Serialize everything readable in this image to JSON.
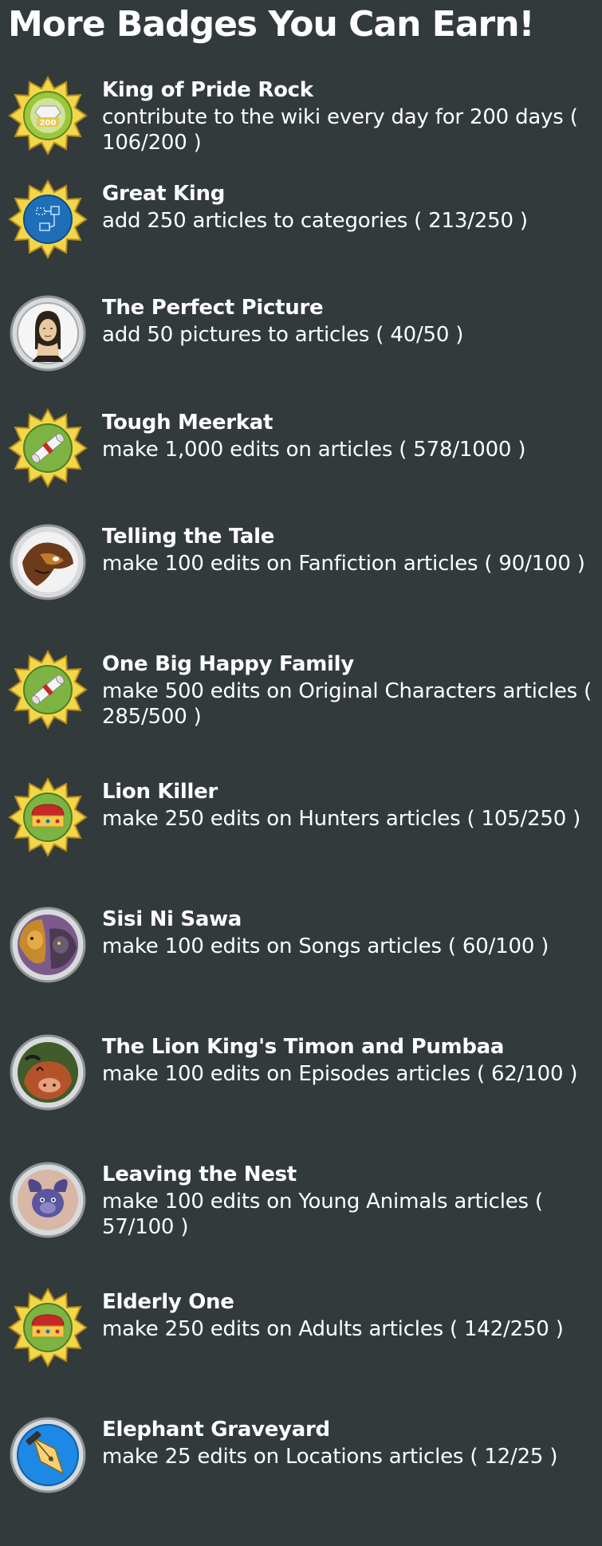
{
  "page": {
    "title": "More Badges You Can Earn!"
  },
  "badges": [
    {
      "name": "King of Pride Rock",
      "description": "contribute to the wiki every day for 200 days ( 106/200 )",
      "icon": "starburst-200-icon",
      "progress": 0.53
    },
    {
      "name": "Great King",
      "description": "add 250 articles to categories ( 213/250 )",
      "icon": "starburst-map-icon",
      "progress": 0.852
    },
    {
      "name": "The Perfect Picture",
      "description": "add 50 pictures to articles ( 40/50 )",
      "icon": "mona-lisa-icon",
      "progress": 0.8
    },
    {
      "name": "Tough Meerkat",
      "description": "make 1,000 edits on articles ( 578/1000 )",
      "icon": "starburst-scroll-icon",
      "progress": 0.578
    },
    {
      "name": "Telling the Tale",
      "description": "make 100 edits on Fanfiction articles ( 90/100 )",
      "icon": "character-portrait-icon",
      "progress": 0.9
    },
    {
      "name": "One Big Happy Family",
      "description": "make 500 edits on Original Characters articles ( 285/500 )",
      "icon": "starburst-scroll-icon",
      "progress": 0.57
    },
    {
      "name": "Lion Killer",
      "description": "make 250 edits on Hunters articles ( 105/250 )",
      "icon": "starburst-crown-icon",
      "progress": 0.42
    },
    {
      "name": "Sisi Ni Sawa",
      "description": "make 100 edits on Songs articles ( 60/100 )",
      "icon": "character-portrait-icon",
      "progress": 0.6
    },
    {
      "name": "The Lion King's Timon and Pumbaa",
      "description": "make 100 edits on Episodes articles ( 62/100 )",
      "icon": "character-portrait-icon",
      "progress": 0.62
    },
    {
      "name": "Leaving the Nest",
      "description": "make 100 edits on Young Animals articles ( 57/100 )",
      "icon": "character-portrait-icon",
      "progress": 0.57
    },
    {
      "name": "Elderly One",
      "description": "make 250 edits on Adults articles ( 142/250 )",
      "icon": "starburst-crown-icon",
      "progress": 0.568
    },
    {
      "name": "Elephant Graveyard",
      "description": "make 25 edits on Locations articles ( 12/25 )",
      "icon": "pen-nib-icon",
      "progress": 0.48
    }
  ],
  "colors": {
    "background": "#333a3c",
    "text": "#ffffff",
    "badge_gold": "#f2d64b",
    "badge_green": "#7cb342",
    "badge_blue": "#1e6fb8",
    "badge_silver": "#d8dadc"
  }
}
